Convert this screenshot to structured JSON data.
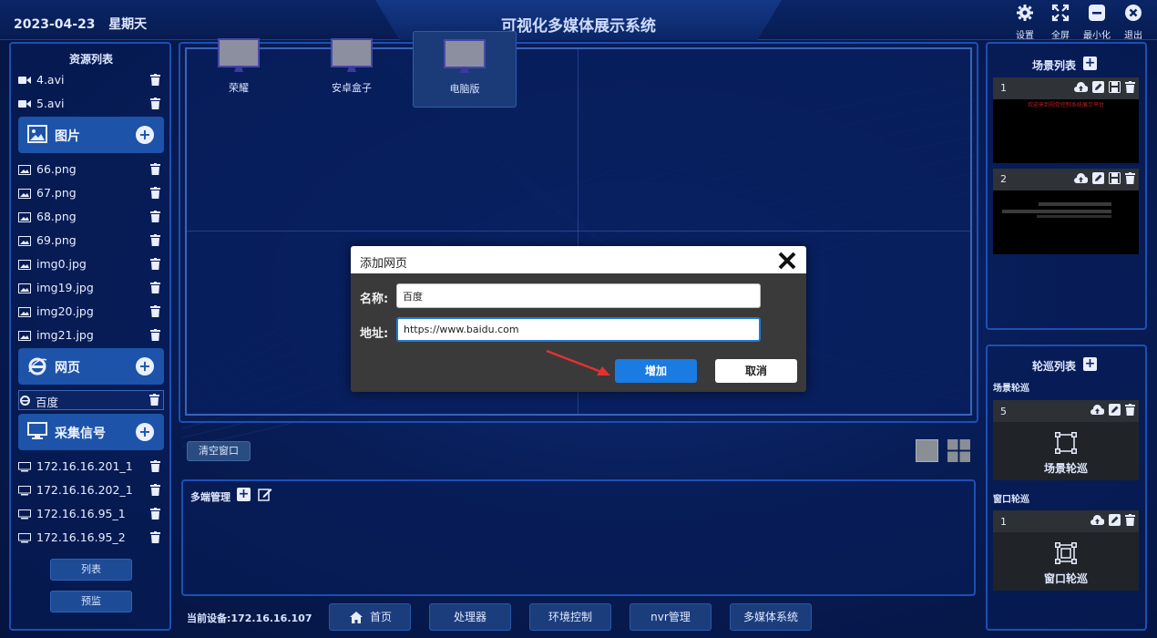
{
  "header": {
    "date": "2023-04-23",
    "weekday": "星期天",
    "title": "可视化多媒体展示系统",
    "buttons": [
      {
        "label": "设置",
        "icon": "gear-icon"
      },
      {
        "label": "全屏",
        "icon": "fullscreen-icon"
      },
      {
        "label": "最小化",
        "icon": "minimize-icon"
      },
      {
        "label": "退出",
        "icon": "close-icon"
      }
    ]
  },
  "resources": {
    "title": "资源列表",
    "videos": [
      "4.avi",
      "5.avi"
    ],
    "images_label": "图片",
    "images": [
      "66.png",
      "67.png",
      "68.png",
      "69.png",
      "img0.jpg",
      "img19.jpg",
      "img20.jpg",
      "img21.jpg"
    ],
    "webpages_label": "网页",
    "webpages": [
      "百度"
    ],
    "signals_label": "采集信号",
    "signals": [
      "172.16.16.201_1",
      "172.16.16.202_1",
      "172.16.16.95_1",
      "172.16.16.95_2"
    ],
    "list_button": "列表",
    "preview_button": "预监"
  },
  "main": {
    "clear_button": "清空窗口"
  },
  "multi": {
    "title": "多端管理",
    "devices": [
      "荣耀",
      "安卓盒子",
      "电脑版"
    ],
    "selected": "电脑版"
  },
  "footer": {
    "current_device": "当前设备:172.16.16.107",
    "nav": [
      "首页",
      "处理器",
      "环境控制",
      "nvr管理",
      "多媒体系统"
    ]
  },
  "scenes": {
    "title": "场景列表",
    "items": [
      {
        "num": "1",
        "preview_text": "欢迎来到视觉控制系统展示平台"
      },
      {
        "num": "2"
      }
    ]
  },
  "tours": {
    "title": "轮巡列表",
    "scene_tour_label": "场景轮巡",
    "window_tour_label": "窗口轮巡",
    "scene_tour": {
      "num": "5",
      "label": "场景轮巡"
    },
    "window_tour": {
      "num": "1",
      "label": "窗口轮巡"
    }
  },
  "dialog": {
    "title": "添加网页",
    "name_label": "名称:",
    "name_value": "百度",
    "url_label": "地址:",
    "url_value": "https://www.baidu.com",
    "ok_label": "增加",
    "cancel_label": "取消"
  },
  "colors": {
    "background": "#06174a",
    "accent": "#1a7be3",
    "panel_border": "#1d4fb4"
  }
}
